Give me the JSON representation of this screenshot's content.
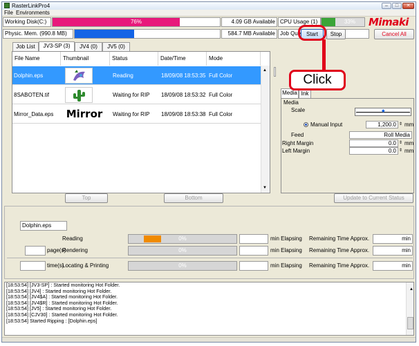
{
  "window": {
    "title": "RasterLinkPro4"
  },
  "menu": {
    "file": "File",
    "environments": "Environments"
  },
  "status": {
    "working_disk_label": "Working Disk(C:)",
    "working_disk_pct": "76%",
    "working_disk_fill": 0.76,
    "working_disk_available": "4.09 GB Available",
    "phys_mem_label": "Physic. Mem. (990.8 MB)",
    "phys_mem_pct": "41%",
    "phys_mem_fill": 0.41,
    "phys_mem_available": "584.7 MB Available",
    "cpu_label": "CPU Usage (1)",
    "cpu_pct": "33%",
    "cpu_fill": 0.33,
    "job_queue_label": "Job Queue",
    "start_label": "Start",
    "stop_label": "Stop",
    "cancel_all_label": "Cancel All",
    "brand": "Mimaki"
  },
  "tabs": [
    "Job List",
    "JV3-SP (3)",
    "JV4 (0)",
    "JV5 (0)"
  ],
  "table": {
    "headers": [
      "File Name",
      "Thumbnail",
      "Status",
      "Date/Time",
      "Mode"
    ],
    "rows": [
      {
        "file": "Dolphin.eps",
        "status": "Reading",
        "date": "18/09/08 18:53:35",
        "mode": "Full Color",
        "selected": true,
        "thumb": "dolphin"
      },
      {
        "file": "8SABOTEN.tif",
        "status": "Waiting for RIP",
        "date": "18/09/08 18:53:32",
        "mode": "Full Color",
        "selected": false,
        "thumb": "cactus"
      },
      {
        "file": "Mirror_Data.eps",
        "status": "Waiting for RIP",
        "date": "18/09/08 18:53:38",
        "mode": "Full Color",
        "selected": false,
        "thumb": "Mirror"
      }
    ],
    "top_label": "Top",
    "bottom_label": "Bottom"
  },
  "media_panel": {
    "tab_media": "Media",
    "tab_ink": "Ink",
    "media_label": "Media",
    "scale_label": "Scale",
    "manual_input_label": "Manual Input",
    "manual_input_value": "1,200.0",
    "feed_label": "Feed",
    "feed_value": "Roll Media",
    "right_margin_label": "Right Margin",
    "right_margin_value": "0.0",
    "left_margin_label": "Left Margin",
    "left_margin_value": "0.0",
    "unit": "mm",
    "update_label": "Update to Current Status"
  },
  "callout": {
    "text": "Click"
  },
  "progress": {
    "current_file": "Dolphin.eps",
    "pages_label": "page(s)",
    "times_label": "time(s)",
    "rows": [
      {
        "label": "Reading",
        "pct": "0%",
        "fill": 0.0
      },
      {
        "label": "Rendering",
        "pct": "0%",
        "fill": 0.0
      },
      {
        "label": "Locating & Printing",
        "pct": "0%",
        "fill": 0.0
      }
    ],
    "elapsing_label": "min Elapsing",
    "remaining_label": "Remaining Time Approx.",
    "min_label": "min"
  },
  "log": [
    "[18:53:54] [JV3-SP] : Started monitoring Hot Folder.",
    "[18:53:54] [JV4] : Started monitoring Hot Folder.",
    "[18:53:54] [JV4$A] : Started monitoring Hot Folder.",
    "[18:53:54] [JV4$R] : Started monitoring Hot Folder.",
    "[18:53:54] [JV5] : Started monitoring Hot Folder.",
    "[18:53:54] [CJV30] : Started monitoring Hot Folder.",
    "[18:53:54] Started Ripping : [Dolphin.eps]"
  ],
  "colors": {
    "disk": "#e8197b",
    "mem": "#1464e6",
    "cpu": "#3aa537",
    "brand": "#e0001a",
    "callout": "#e0001a",
    "selection": "#3399ff",
    "reading_fill": "#f08a00"
  }
}
